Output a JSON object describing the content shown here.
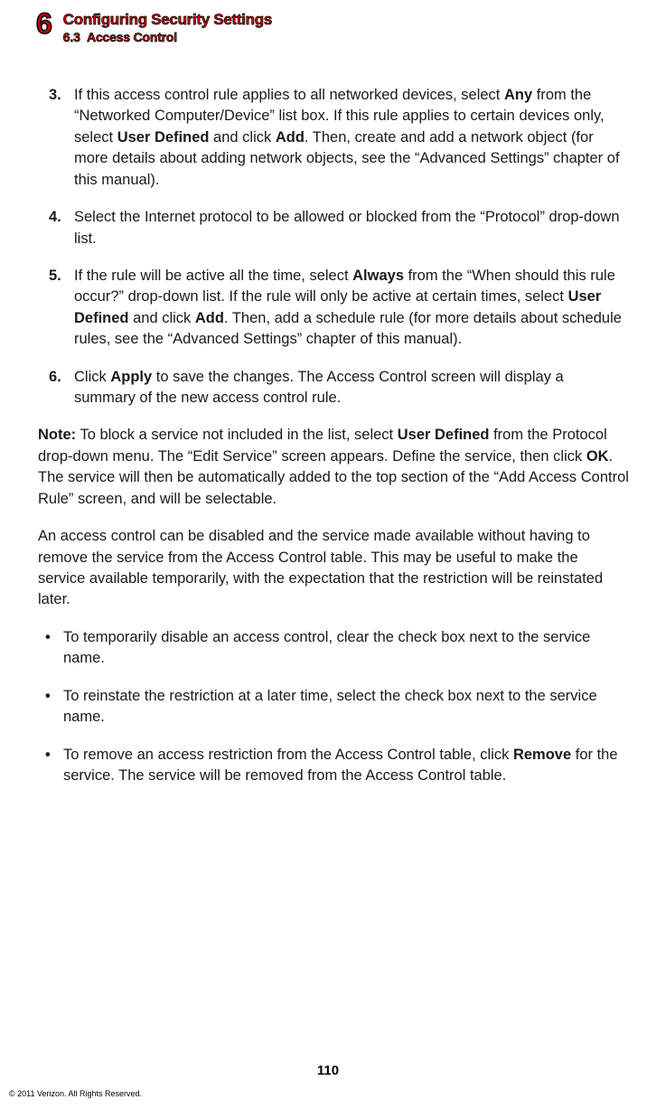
{
  "header": {
    "chapter_number": "6",
    "chapter_title": "Configuring Security Settings",
    "section_number": "6.3",
    "section_title": "Access Control"
  },
  "steps": [
    {
      "num": "3.",
      "pre1": "If this access control rule applies to all networked devices, select ",
      "b1": "Any",
      "mid1": " from the “Networked Computer/Device” list box. If this rule applies to certain devices only, select ",
      "b2": "User Defined",
      "mid2": " and click ",
      "b3": "Add",
      "post": ". Then, create and add a network object (for more details about adding network objects, see the “Advanced Settings” chapter of this manual)."
    },
    {
      "num": "4.",
      "pre1": "Select the Internet protocol to be allowed or blocked from the “Protocol” drop-down list.",
      "b1": "",
      "mid1": "",
      "b2": "",
      "mid2": "",
      "b3": "",
      "post": ""
    },
    {
      "num": "5.",
      "pre1": "If the rule will be active all the time, select ",
      "b1": "Always",
      "mid1": " from the “When should this rule occur?” drop-down list. If the rule will only be active at certain times, select ",
      "b2": "User Defined",
      "mid2": " and click ",
      "b3": "Add",
      "post": ". Then, add a schedule rule (for more details about schedule rules, see the “Advanced Settings” chapter of this manual)."
    },
    {
      "num": "6.",
      "pre1": "Click ",
      "b1": "Apply",
      "mid1": " to save the changes. The Access Control screen will display a summary of the new access control rule.",
      "b2": "",
      "mid2": "",
      "b3": "",
      "post": ""
    }
  ],
  "note": {
    "label": "Note:",
    "pre1": " To block a service not included in the list, select ",
    "b1": "User Defined",
    "mid1": " from the Protocol drop-down menu. The “Edit Service” screen appears. Define the service, then click ",
    "b2": "OK",
    "post": ". The service will then be automatically added to the top section of the “Add Access Control Rule” screen, and will be selectable."
  },
  "para_disable": "An access control can be disabled and the service made available without having to remove the service from the Access Control table. This may be useful to make the service available temporarily, with the expectation that the restriction will be reinstated later.",
  "bullets": [
    {
      "pre": "To temporarily disable an access control, clear the check box next to the service name.",
      "b": "",
      "post": ""
    },
    {
      "pre": "To reinstate the restriction at a later time, select the check box next to the service name.",
      "b": "",
      "post": ""
    },
    {
      "pre": "To remove an access restriction from the Access Control table, click ",
      "b": "Remove",
      "post": " for the service. The service will be removed from the Access Control table."
    }
  ],
  "page_number": "110",
  "copyright": "© 2011 Verizon. All Rights Reserved."
}
